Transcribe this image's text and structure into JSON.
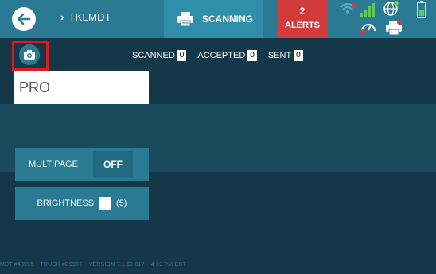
{
  "header": {
    "route_label": "TKLMDT",
    "scan_tab_label": "SCANNING",
    "alerts_count": "2",
    "alerts_label": "ALERTS"
  },
  "counters": {
    "scanned_label": "SCANNED",
    "scanned_value": "0",
    "accepted_label": "ACCEPTED",
    "accepted_value": "0",
    "sent_label": "SENT",
    "sent_value": "0"
  },
  "form": {
    "pro_value": "PRO"
  },
  "controls": {
    "multipage_label": "MULTIPAGE",
    "multipage_state": "OFF",
    "brightness_label": "BRIGHTNESS",
    "brightness_value": "(5)"
  },
  "footer": {
    "mdt": "MDT #43955",
    "truck": "TRUCK #D9907",
    "version": "VERSION  7.1.60.017",
    "time": "4:09 PM EDT"
  },
  "colors": {
    "brand": "#2a7a94",
    "alerts": "#d23b3b",
    "highlight": "#e01919",
    "background": "#143847"
  },
  "icons": [
    "back-arrow-icon",
    "chevron-right-icon",
    "printer-icon",
    "wifi-icon",
    "signal-bars-icon",
    "globe-icon",
    "battery-icon",
    "gauge-icon",
    "camera-icon"
  ]
}
